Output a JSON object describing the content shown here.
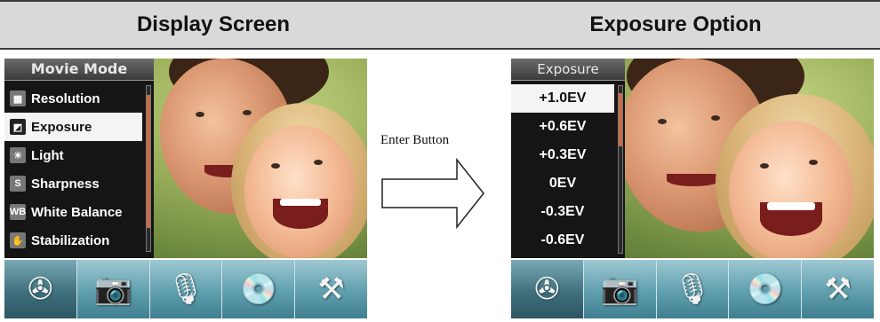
{
  "headers": {
    "left": "Display Screen",
    "right": "Exposure Option"
  },
  "left_screen": {
    "menu_title": "Movie Mode",
    "items": [
      {
        "label": "Resolution",
        "icon": "resolution-icon",
        "glyph": "▦"
      },
      {
        "label": "Exposure",
        "icon": "exposure-icon",
        "glyph": "◩",
        "selected": true
      },
      {
        "label": "Light",
        "icon": "light-icon",
        "glyph": "☀"
      },
      {
        "label": "Sharpness",
        "icon": "sharpness-icon",
        "glyph": "S"
      },
      {
        "label": "White Balance",
        "icon": "white-balance-icon",
        "glyph": "WB"
      },
      {
        "label": "Stabilization",
        "icon": "stabilization-icon",
        "glyph": "✋"
      }
    ]
  },
  "right_screen": {
    "menu_title": "Exposure",
    "options": [
      {
        "label": "+1.0EV",
        "selected": true
      },
      {
        "label": "+0.6EV"
      },
      {
        "label": "+0.3EV"
      },
      {
        "label": "0EV"
      },
      {
        "label": "-0.3EV"
      },
      {
        "label": "-0.6EV"
      }
    ]
  },
  "tabs": [
    {
      "icon": "movie-reel-icon",
      "glyph": "✇",
      "active": true
    },
    {
      "icon": "camera-icon",
      "glyph": "📷"
    },
    {
      "icon": "microphone-icon",
      "glyph": "🎙"
    },
    {
      "icon": "playback-disc-icon",
      "glyph": "💿"
    },
    {
      "icon": "tools-icon",
      "glyph": "⚒"
    }
  ],
  "arrow_label": "Enter Button",
  "colors": {
    "menu_bg": "#151515",
    "selected_bg": "#f4f4f4",
    "tab_teal": "#5f9fae",
    "scroll_thumb": "#c86a47"
  }
}
